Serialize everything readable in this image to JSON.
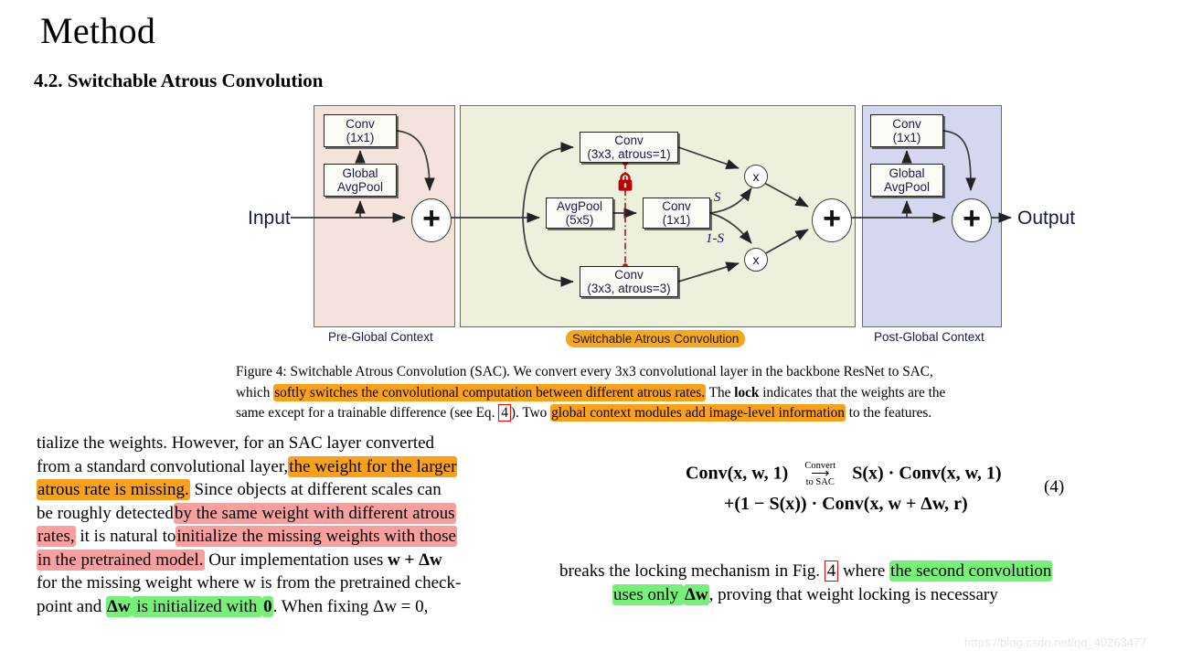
{
  "page_title": "Method",
  "section_heading": "4.2. Switchable Atrous Convolution",
  "figure": {
    "input_label": "Input",
    "output_label": "Output",
    "panels": [
      {
        "name": "pre-global-context",
        "caption": "Pre-Global Context",
        "color": "#f4e3dc"
      },
      {
        "name": "switchable-atrous-convolution",
        "caption": "Switchable Atrous Convolution",
        "color": "#ecf0dc",
        "caption_highlight": "#f5a623"
      },
      {
        "name": "post-global-context",
        "caption": "Post-Global Context",
        "color": "#d5d7ef"
      }
    ],
    "boxes": {
      "pre_conv_l1": "Conv",
      "pre_conv_l2": "(1x1)",
      "pre_pool_l1": "Global",
      "pre_pool_l2": "AvgPool",
      "sac_conv_atrous1_l1": "Conv",
      "sac_conv_atrous1_l2": "(3x3, atrous=1)",
      "sac_avgpool_l1": "AvgPool",
      "sac_avgpool_l2": "(5x5)",
      "sac_conv1x1_l1": "Conv",
      "sac_conv1x1_l2": "(1x1)",
      "sac_conv_atrous3_l1": "Conv",
      "sac_conv_atrous3_l2": "(3x3, atrous=3)",
      "post_conv_l1": "Conv",
      "post_conv_l2": "(1x1)",
      "post_pool_l1": "Global",
      "post_pool_l2": "AvgPool"
    },
    "operators": {
      "plus": "+",
      "multiply": "x"
    },
    "switch_labels": {
      "s": "S",
      "one_minus_s_prefix": "1",
      "one_minus_s_suffix": "-S"
    },
    "lock_color": "#c00000",
    "lock_line_color": "#b22222"
  },
  "figure_caption": {
    "line1_a": "Figure 4: Switchable Atrous Convolution (SAC). We convert every 3x3 convolutional layer in the backbone ResNet to SAC,",
    "line2_a": "which ",
    "line2_hl": "softly switches the convolutional computation between different atrous rates.",
    "line2_b": " The ",
    "line2_bold": "lock",
    "line2_c": " indicates that the weights are the",
    "line3_a": "same except for a trainable difference (see Eq. ",
    "line3_ref": "4",
    "line3_b": "). Two ",
    "line3_hl": "global context modules add image-level information",
    "line3_c": " to the features."
  },
  "left_column": {
    "l1": "tialize the weights.  However, for an SAC layer converted",
    "l2_a": "from a standard convolutional layer,",
    "l2_hl": "the weight for the larger",
    "l3_hl": "atrous rate is missing.",
    "l3_b": " Since objects at different scales can",
    "l4_a": "be roughly detected",
    "l4_hl": "by the same weight with different atrous",
    "l5_hl_a": "rates,",
    "l5_b": " it is natural to",
    "l5_hl_b": "initialize the missing weights with those",
    "l6_hl": "in the pretrained model.",
    "l6_b": " Our implementation uses ",
    "l6_math": "w + Δw",
    "l7": "for the missing weight where w is from the pretrained check-",
    "l8_a": "point and ",
    "l8_hl_a": "Δw",
    "l8_hl_b": " is initialized with ",
    "l8_hl_c": "0",
    "l8_b": ". When fixing Δw = 0,"
  },
  "equation": {
    "line1_pre": "Conv(x, w, 1)",
    "arrow_top": "Convert",
    "arrow_glyph": "⟶",
    "arrow_bot": "to SAC",
    "line1_post": "S(x) · Conv(x, w, 1)",
    "line2": "+(1 − S(x)) · Conv(x, w + Δw, r)",
    "number": "(4)"
  },
  "right_column": {
    "l1_a": "breaks the  locking mechanism in Fig. ",
    "l1_ref": "4",
    "l1_b": " where ",
    "l1_hl": "the second convolution",
    "l2_hl_a": "uses only ",
    "l2_hl_b": "Δw",
    "l2_b": ", proving that weight locking is necessary"
  },
  "watermark": "https://blog.csdn.net/qq_40263477"
}
